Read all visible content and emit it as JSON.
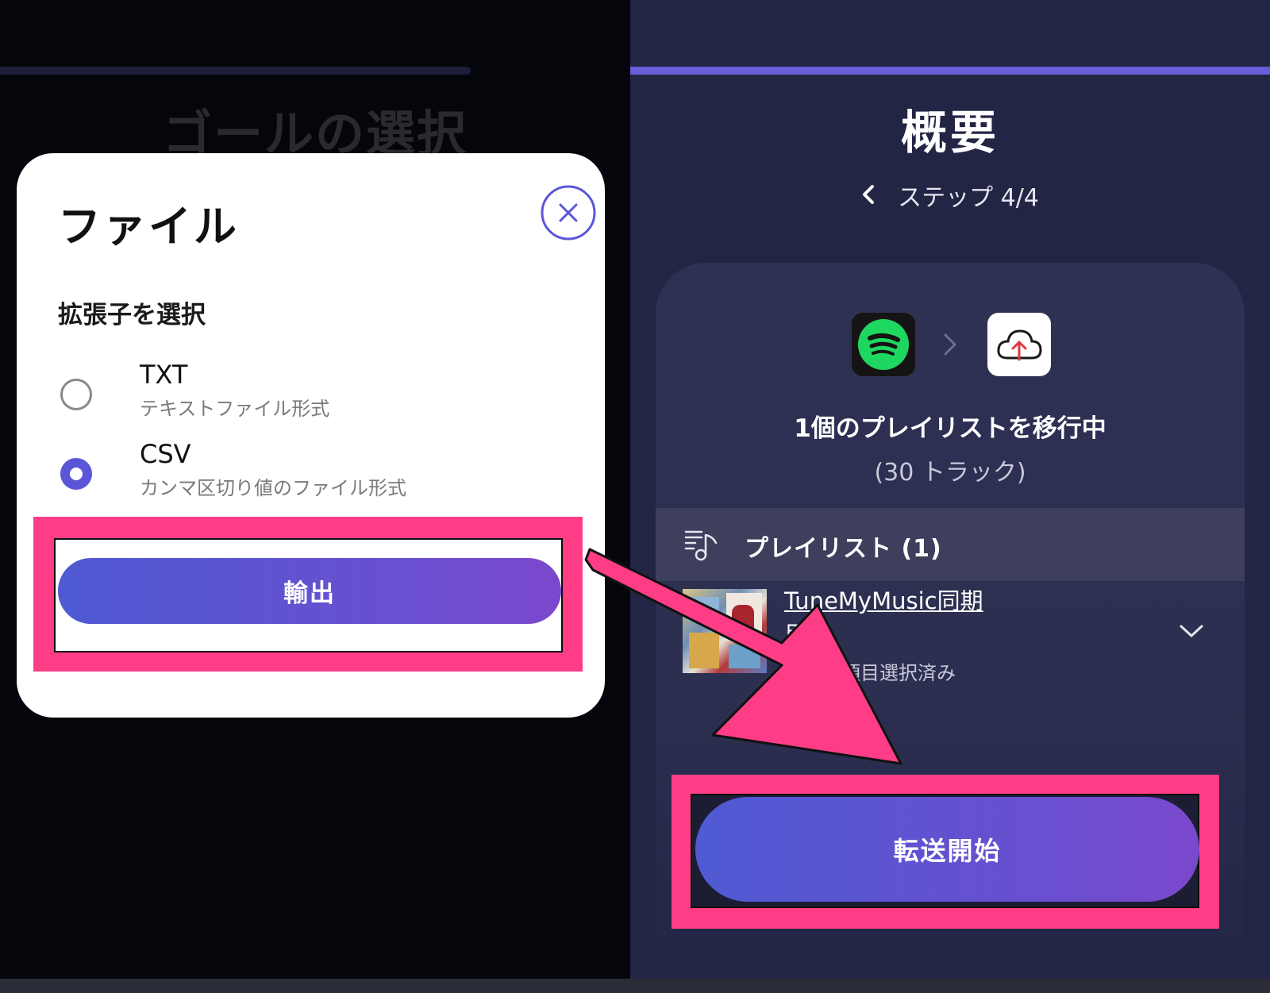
{
  "left_panel": {
    "background_title": "ゴールの選択",
    "modal": {
      "title": "ファイル",
      "close_icon": "close-icon",
      "section_label": "拡張子を選択",
      "options": [
        {
          "name": "TXT",
          "description": "テキストファイル形式",
          "selected": false
        },
        {
          "name": "CSV",
          "description": "カンマ区切り値のファイル形式",
          "selected": true
        }
      ],
      "export_label": "輸出"
    }
  },
  "right_panel": {
    "title": "概要",
    "step_label": "ステップ 4/4",
    "back_icon": "chevron-left-icon",
    "source_service_icon": "spotify-icon",
    "destination_service_icon": "cloud-upload-icon",
    "transfer_title": "1個のプレイリストを移行中",
    "transfer_subtitle": "(30 トラック)",
    "playlist_section_label": "プレイリスト (1)",
    "playlist": {
      "name": "TuneMyMusic同期",
      "name_line2": "用",
      "selected_count": "項目選択済み"
    },
    "start_label": "転送開始"
  },
  "colors": {
    "accent": "#5b56d8",
    "highlight": "#ff3d86",
    "spotify_green": "#1ed760",
    "right_bg": "#232544"
  }
}
